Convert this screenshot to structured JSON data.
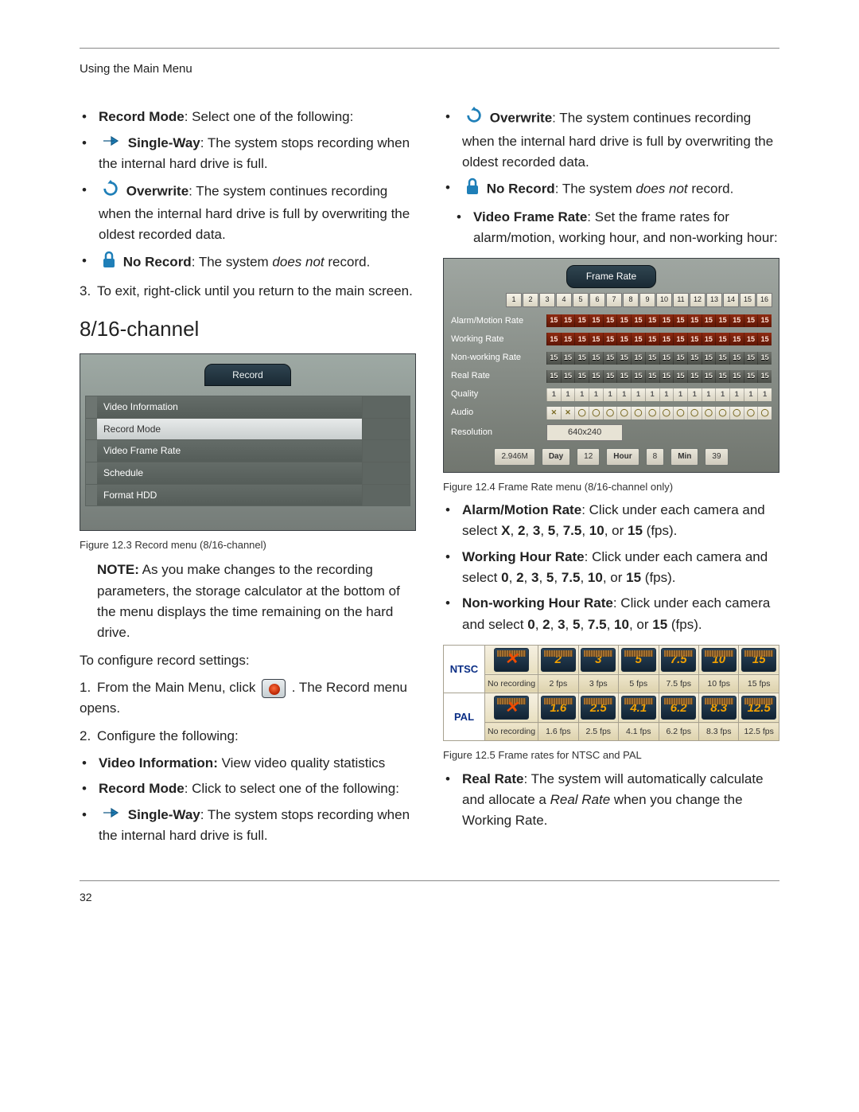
{
  "running_head": "Using the Main Menu",
  "left": {
    "record_mode_label": "Record Mode",
    "record_mode_text": ": Select one of the following:",
    "single_way_label": "Single-Way",
    "single_way_text": ": The system stops recording when the internal hard drive is full.",
    "overwrite_label": "Overwrite",
    "overwrite_text": ": The system continues recording when the internal hard drive is full by overwriting the oldest recorded data.",
    "no_record_label": "No Record",
    "no_record_pre": ": The system ",
    "no_record_em": "does not",
    "no_record_post": " record.",
    "step3": "To exit, right-click until you return to the main screen.",
    "subsection_title": "8/16-channel",
    "fig3": {
      "ribbon": "Record",
      "rows": [
        "Video Information",
        "Record Mode",
        "Video Frame Rate",
        "Schedule",
        "Format HDD"
      ],
      "caption": "Figure 12.3 Record menu (8/16-channel)"
    },
    "note_bold": "NOTE:",
    "note_text": " As you make changes to the recording parameters, the storage calculator at the bottom of the menu displays the time remaining on the hard drive.",
    "to_configure": "To configure record settings:",
    "step1a": "From the Main Menu, click ",
    "step1b": " . The Record menu opens.",
    "step2": "Configure the following:",
    "video_info_label": "Video Information:",
    "video_info_text": " View video quality statistics",
    "record_mode2_label": "Record Mode",
    "record_mode2_text": ": Click to select one of the following:",
    "single_way2_label": "Single-Way",
    "single_way2_text": ": The system stops recording when the internal hard drive is full."
  },
  "right": {
    "overwrite_label": "Overwrite",
    "overwrite_text": ": The system continues recording when the internal hard drive is full by overwriting the oldest recorded data.",
    "no_record_label": "No Record",
    "no_record_pre": ": The system ",
    "no_record_em": "does not",
    "no_record_post": " record.",
    "vfr_label": "Video Frame Rate",
    "vfr_text": ": Set the frame rates for alarm/motion, working hour, and non-working hour:",
    "fig4": {
      "title_ribbon": "Frame Rate",
      "num_cols": 16,
      "rows": {
        "alarm": {
          "label": "Alarm/Motion Rate",
          "val": "15",
          "style": "red"
        },
        "working": {
          "label": "Working Rate",
          "val": "15",
          "style": "red"
        },
        "nonworking": {
          "label": "Non-working Rate",
          "val": "15",
          "style": "gray"
        },
        "real": {
          "label": "Real Rate",
          "val": "15",
          "style": "gray"
        },
        "quality": {
          "label": "Quality",
          "val": "1",
          "style": "q"
        },
        "audio": {
          "label": "Audio",
          "first2": "✕",
          "rest": "◯",
          "style": "audio"
        },
        "resolution": {
          "label": "Resolution",
          "value": "640x240"
        }
      },
      "footer": {
        "total": "2.946M",
        "day_lbl": "Day",
        "day": "12",
        "hour_lbl": "Hour",
        "hour": "8",
        "min_lbl": "Min",
        "min": "39"
      },
      "caption": "Figure 12.4 Frame Rate menu (8/16-channel only)"
    },
    "alarm_rate_label": "Alarm/Motion Rate",
    "alarm_rate_pre": ": Click under each camera and select ",
    "alarm_rate_vals": [
      "X",
      "2",
      "3",
      "5",
      "7.5",
      "10",
      "15"
    ],
    "alarm_rate_post": " (fps).",
    "working_rate_label": "Working Hour Rate",
    "working_rate_pre": ": Click under each camera and select ",
    "working_rate_vals": [
      "0",
      "2",
      "3",
      "5",
      "7.5",
      "10",
      "15"
    ],
    "working_rate_post": " (fps).",
    "nonworking_rate_label": "Non-working Hour Rate",
    "nonworking_rate_pre": ": Click under each camera and select ",
    "nonworking_rate_vals": [
      "0",
      "2",
      "3",
      "5",
      "7.5",
      "10",
      "15"
    ],
    "nonworking_rate_post": " (fps).",
    "fig5": {
      "systems": [
        "NTSC",
        "PAL"
      ],
      "ntsc_icons": [
        "",
        "2",
        "3",
        "5",
        "7.5",
        "10",
        "15"
      ],
      "ntsc_caps": [
        "No recording",
        "2 fps",
        "3 fps",
        "5 fps",
        "7.5 fps",
        "10 fps",
        "15 fps"
      ],
      "pal_icons": [
        "",
        "1.6",
        "2.5",
        "4.1",
        "6.2",
        "8.3",
        "12.5"
      ],
      "pal_caps": [
        "No recording",
        "1.6 fps",
        "2.5 fps",
        "4.1 fps",
        "6.2 fps",
        "8.3 fps",
        "12.5 fps"
      ],
      "caption": "Figure 12.5 Frame rates for NTSC and PAL"
    },
    "real_rate_label": "Real Rate",
    "real_rate_pre": ": The system will automatically calculate and allocate a ",
    "real_rate_em": "Real Rate",
    "real_rate_post": " when you change the Working Rate."
  },
  "page_number": "32"
}
